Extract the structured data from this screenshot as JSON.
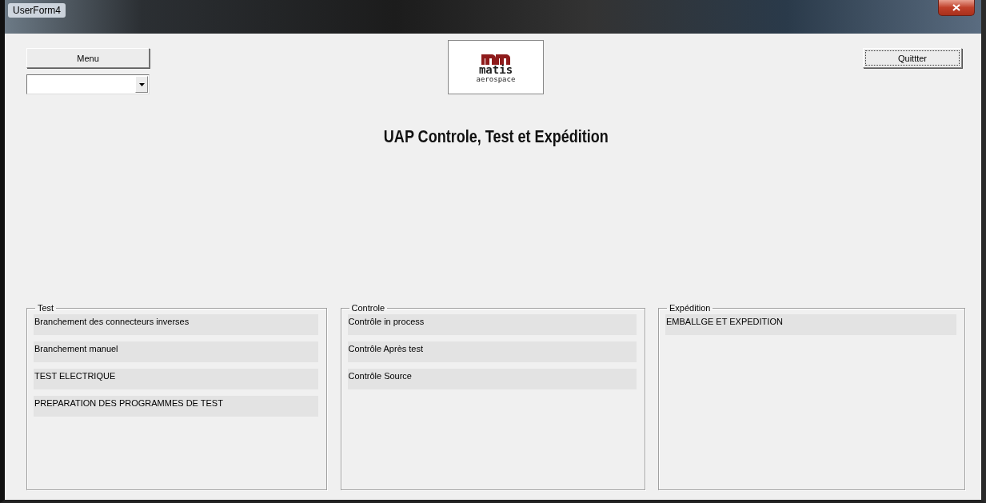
{
  "window": {
    "title": "UserForm4"
  },
  "menu_button": {
    "label": "Menu"
  },
  "logo": {
    "name": "matis",
    "tagline": "aerospace"
  },
  "quit_button": {
    "label": "Quittter"
  },
  "heading": "UAP Controle, Test et Expédition",
  "frames": [
    {
      "title": "Test",
      "items": [
        "Branchement des connecteurs inverses",
        "Branchement manuel",
        "TEST ELECTRIQUE",
        "PREPARATION DES PROGRAMMES DE TEST"
      ]
    },
    {
      "title": "Controle",
      "items": [
        "Contrôle in process",
        "Contrôle Après test",
        "Contrôle Source"
      ]
    },
    {
      "title": "Expédition",
      "items": [
        "EMBALLGE ET EXPEDITION"
      ]
    }
  ]
}
